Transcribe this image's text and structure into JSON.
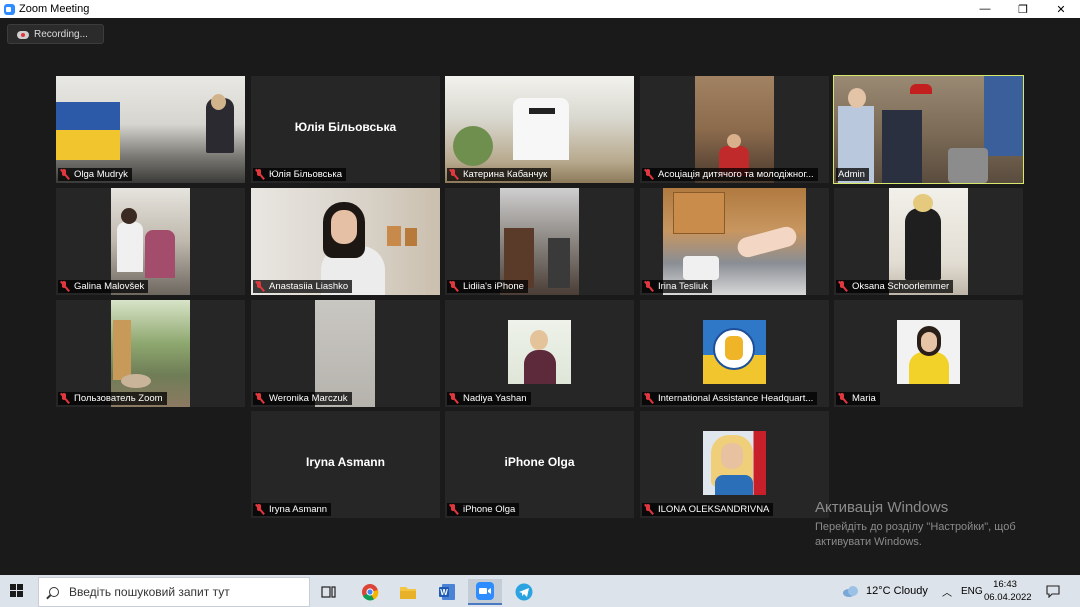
{
  "window": {
    "title": "Zoom Meeting",
    "minimize": "—",
    "maximize": "❐",
    "close": "✕"
  },
  "recording": {
    "label": "Recording..."
  },
  "participants": [
    {
      "name": "Olga Mudryk"
    },
    {
      "name": "Юлія Більовська",
      "center_name": "Юлія Більовська"
    },
    {
      "name": "Катерина Кабанчук"
    },
    {
      "name": "Асоціація дитячого та молодіжног..."
    },
    {
      "name": "Admin",
      "active_speaker": true
    },
    {
      "name": "Galina Malovšek"
    },
    {
      "name": "Anastasiia Liashko"
    },
    {
      "name": "Lidiia's iPhone"
    },
    {
      "name": "Irina Tesliuk"
    },
    {
      "name": "Oksana Schoorlemmer"
    },
    {
      "name": "Пользователь Zoom"
    },
    {
      "name": "Weronika Marczuk"
    },
    {
      "name": "Nadiya Yashan"
    },
    {
      "name": "International Assistance Headquart..."
    },
    {
      "name": "Maria"
    },
    {
      "name": "Iryna Asmann",
      "center_name": "Iryna Asmann"
    },
    {
      "name": "iPhone Olga",
      "center_name": "iPhone Olga"
    },
    {
      "name": "ILONA OLEKSANDRIVNA"
    }
  ],
  "watermark": {
    "title": "Активація Windows",
    "text": "Перейдіть до розділу \"Настройки\", щоб активувати Windows."
  },
  "taskbar": {
    "search_placeholder": "Введіть пошуковий запит тут",
    "apps": [
      "task-view",
      "chrome",
      "file-explorer",
      "word",
      "zoom",
      "telegram"
    ],
    "weather": "12°C  Cloudy",
    "language": "ENG",
    "time": "16:43",
    "date": "06.04.2022"
  },
  "colors": {
    "active_speaker_border": "#d7e86a",
    "mute_red": "#e0383e",
    "zoom_blue": "#2d8cff"
  }
}
